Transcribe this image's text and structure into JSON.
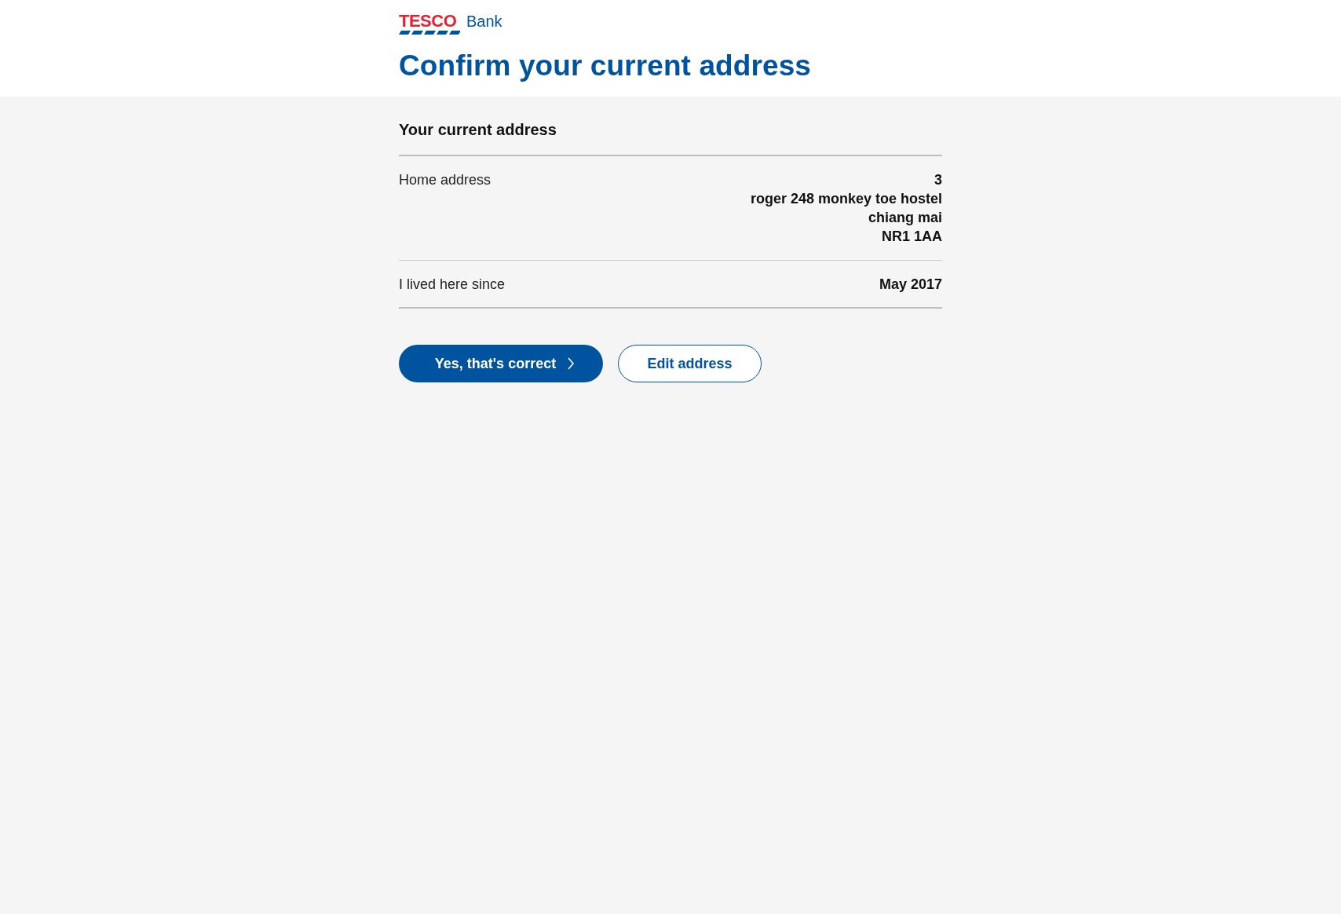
{
  "header": {
    "logo": {
      "wordmark": "TESCO",
      "product": "Bank"
    },
    "title": "Confirm your current address"
  },
  "section": {
    "heading": "Your current address",
    "rows": [
      {
        "label": "Home address",
        "value_lines": [
          "3",
          "roger 248 monkey toe hostel",
          "chiang mai",
          "NR1 1AA"
        ]
      },
      {
        "label": "I lived here since",
        "value_lines": [
          "May 2017"
        ]
      }
    ]
  },
  "actions": [
    {
      "kind": "primary",
      "label": "Yes, that's correct"
    },
    {
      "kind": "secondary",
      "label": "Edit address"
    }
  ]
}
